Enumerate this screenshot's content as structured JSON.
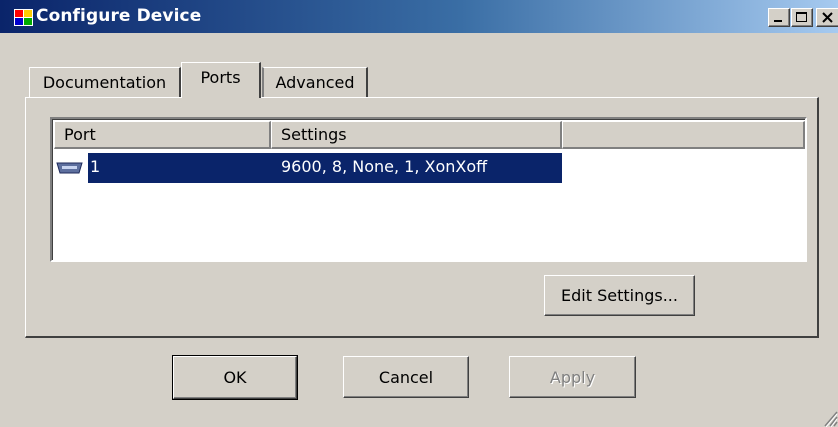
{
  "window": {
    "title": "Configure Device",
    "controls": {
      "minimize": "_",
      "maximize": "□",
      "close": "×"
    }
  },
  "tabs": [
    {
      "label": "Documentation",
      "selected": false
    },
    {
      "label": "Ports",
      "selected": true
    },
    {
      "label": "Advanced",
      "selected": false
    }
  ],
  "ports_list": {
    "columns": [
      "Port",
      "Settings",
      ""
    ],
    "rows": [
      {
        "icon": "serial-port-icon",
        "port": "1",
        "settings": "9600, 8, None, 1, XonXoff",
        "selected": true
      }
    ]
  },
  "buttons": {
    "edit_settings": "Edit Settings...",
    "ok": "OK",
    "cancel": "Cancel",
    "apply": "Apply"
  },
  "colors": {
    "face": "#d4d0c8",
    "titlebar_start": "#0a246a",
    "titlebar_end": "#a6caf0",
    "selection": "#0a246a",
    "disabled_text": "#808080"
  }
}
